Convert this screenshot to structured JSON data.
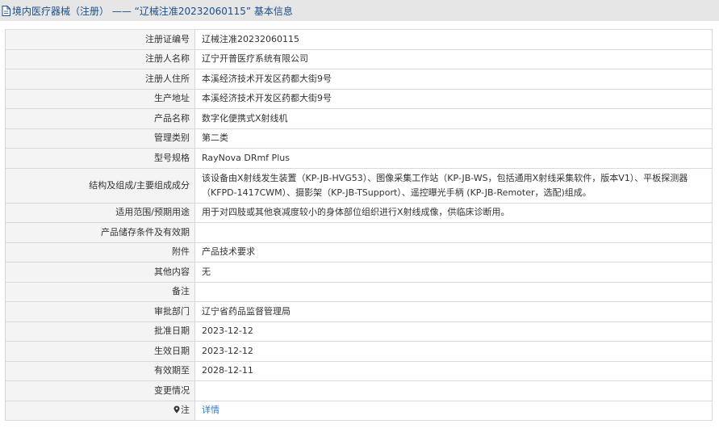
{
  "header": {
    "text": "境内医疗器械（注册） —— “辽械注准20232060115” 基本信息",
    "icon": "document-icon"
  },
  "rows": [
    {
      "label": "注册证编号",
      "value": "辽械注准20232060115"
    },
    {
      "label": "注册人名称",
      "value": "辽宁开普医疗系统有限公司"
    },
    {
      "label": "注册人住所",
      "value": "本溪经济技术开发区药都大街9号"
    },
    {
      "label": "生产地址",
      "value": "本溪经济技术开发区药都大街9号"
    },
    {
      "label": "产品名称",
      "value": "数字化便携式X射线机"
    },
    {
      "label": "管理类别",
      "value": "第二类"
    },
    {
      "label": "型号规格",
      "value": "RayNova DRmf Plus"
    },
    {
      "label": "结构及组成/主要组成成分",
      "value": "该设备由X射线发生装置（KP-JB-HVG53）、图像采集工作站（KP-JB-WS，包括通用X射线采集软件，版本V1）、平板探测器（KFPD-1417CWM）、摄影架（KP-JB-TSupport）、遥控曝光手柄 (KP-JB-Remoter，选配)组成。"
    },
    {
      "label": "适用范围/预期用途",
      "value": "用于对四肢或其他衰减度较小的身体部位组织进行X射线成像，供临床诊断用。"
    },
    {
      "label": "产品储存条件及有效期",
      "value": ""
    },
    {
      "label": "附件",
      "value": "产品技术要求"
    },
    {
      "label": "其他内容",
      "value": "无"
    },
    {
      "label": "备注",
      "value": ""
    },
    {
      "label": "审批部门",
      "value": "辽宁省药品监督管理局"
    },
    {
      "label": "批准日期",
      "value": "2023-12-12"
    },
    {
      "label": "生效日期",
      "value": "2023-12-12"
    },
    {
      "label": "有效期至",
      "value": "2028-12-11"
    },
    {
      "label": "变更情况",
      "value": ""
    }
  ],
  "note": {
    "label": "注",
    "icon": "pin-icon",
    "link": "详情"
  },
  "colors": {
    "header_bg": "#e6e6e6",
    "header_text": "#1a4e8a",
    "label_bg": "#f4f4f4",
    "border": "#d9d9d9",
    "link": "#2f7bd4"
  }
}
